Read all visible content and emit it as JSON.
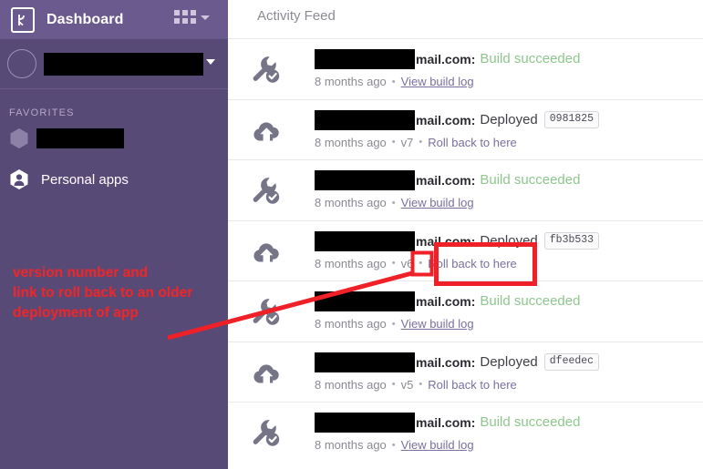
{
  "sidebar": {
    "logo_name": "heroku-logo",
    "title": "Dashboard",
    "grid_menu_label": "apps-grid-menu",
    "account": {
      "name_redacted": true,
      "chevron": "chevron-down-icon"
    },
    "favorites_label": "FAVORITES",
    "favorites": [
      {
        "label": "",
        "redacted": true,
        "icon": "hexagon-icon"
      }
    ],
    "personal_apps": {
      "label": "Personal apps",
      "icon": "hexagon-person-icon"
    }
  },
  "main": {
    "header": "Activity Feed",
    "rows": [
      {
        "icon": "wrench-check-icon",
        "user_redacted": true,
        "user_suffix": "mail.com",
        "colon": ":",
        "action": "Build succeeded",
        "action_type": "build",
        "hash": "",
        "time": "8 months ago",
        "version": "",
        "link": "View build log",
        "link_style": "underline"
      },
      {
        "icon": "cloud-upload-icon",
        "user_redacted": true,
        "user_suffix": "mail.com",
        "colon": ":",
        "action": "Deployed",
        "action_type": "deploy",
        "hash": "0981825",
        "time": "8 months ago",
        "version": "v7",
        "link": "Roll back to here",
        "link_style": "plain"
      },
      {
        "icon": "wrench-check-icon",
        "user_redacted": true,
        "user_suffix": "mail.com",
        "colon": ":",
        "action": "Build succeeded",
        "action_type": "build",
        "hash": "",
        "time": "8 months ago",
        "version": "",
        "link": "View build log",
        "link_style": "underline"
      },
      {
        "icon": "cloud-upload-icon",
        "user_redacted": true,
        "user_suffix": "mail.com",
        "colon": ":",
        "action": "Deployed",
        "action_type": "deploy",
        "hash": "fb3b533",
        "time": "8 months ago",
        "version": "v6",
        "link": "Roll back to here",
        "link_style": "plain"
      },
      {
        "icon": "wrench-check-icon",
        "user_redacted": true,
        "user_suffix": "mail.com",
        "colon": ":",
        "action": "Build succeeded",
        "action_type": "build",
        "hash": "",
        "time": "8 months ago",
        "version": "",
        "link": "View build log",
        "link_style": "underline"
      },
      {
        "icon": "cloud-upload-icon",
        "user_redacted": true,
        "user_suffix": "mail.com",
        "colon": ":",
        "action": "Deployed",
        "action_type": "deploy",
        "hash": "dfeedec",
        "time": "8 months ago",
        "version": "v5",
        "link": "Roll back to here",
        "link_style": "plain"
      },
      {
        "icon": "wrench-check-icon",
        "user_redacted": true,
        "user_suffix": "mail.com",
        "colon": ":",
        "action": "Build succeeded",
        "action_type": "build",
        "hash": "",
        "time": "8 months ago",
        "version": "",
        "link": "View build log",
        "link_style": "underline"
      }
    ]
  },
  "annotation": {
    "text": "version number and\nlink to roll back to an older\ndeployment of app",
    "color": "#ef2027",
    "highlight_version": "v6",
    "highlight_link": "Roll back to here"
  },
  "colors": {
    "sidebar_bg": "#584A77",
    "sidebar_topbar_bg": "#6B5A8E",
    "accent_link": "#7b6fa0",
    "success_green": "#8ec78e",
    "annotation_red": "#ef2027"
  }
}
